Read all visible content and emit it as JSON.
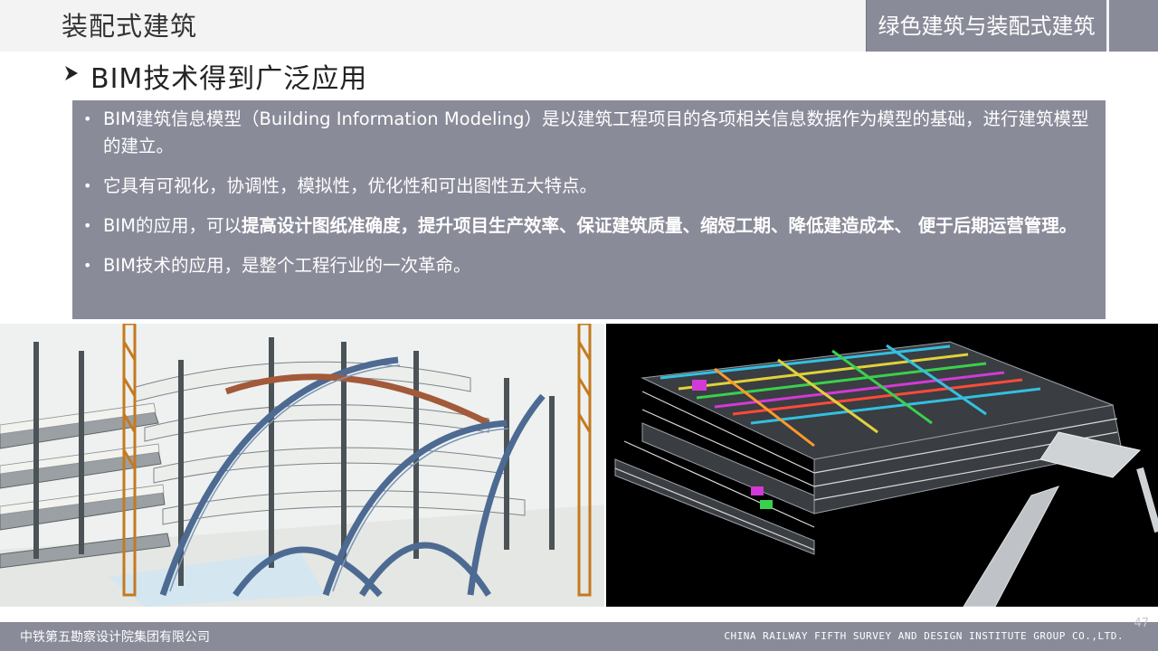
{
  "header": {
    "title": "装配式建筑",
    "section": "绿色建筑与装配式建筑"
  },
  "subtitle": {
    "arrow_icon": "arrow-right-icon",
    "text": "BIM技术得到广泛应用"
  },
  "bullets": [
    {
      "plain": "BIM建筑信息模型（Building Information Modeling）是以建筑工程项目的各项相关信息数据作为模型的基础，进行建筑模型的建立。",
      "bold": "",
      "tail": ""
    },
    {
      "plain": "它具有可视化，协调性，模拟性，优化性和可出图性五大特点。",
      "bold": "",
      "tail": ""
    },
    {
      "plain": "BIM的应用，可以",
      "bold": "提高设计图纸准确度，提升项目生产效率、保证建筑质量、缩短工期、降低建造成本、 便于后期运营管理。",
      "tail": ""
    },
    {
      "plain": "BIM技术的应用，是整个工程行业的一次革命。",
      "bold": "",
      "tail": ""
    }
  ],
  "images": {
    "left": "steel-structure-model-illustration",
    "right": "bim-mep-pipe-model-illustration"
  },
  "footer": {
    "company_cn": "中铁第五勘察设计院集团有限公司",
    "company_en": "CHINA RAILWAY FIFTH SURVEY AND DESIGN INSTITUTE GROUP CO.,LTD.",
    "page": "47"
  },
  "colors": {
    "accent": "#8a8b99",
    "header_bg": "#f3f3f3"
  }
}
